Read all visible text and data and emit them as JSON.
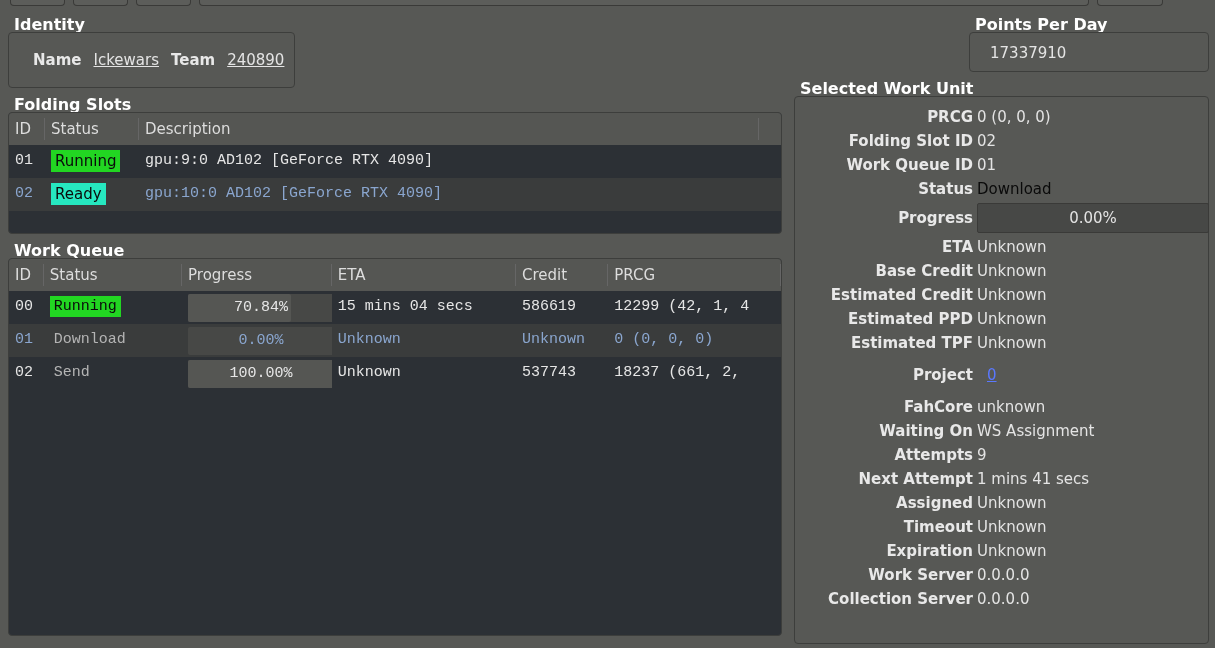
{
  "identity": {
    "title": "Identity",
    "name_label": "Name",
    "name": "Ickewars",
    "team_label": "Team",
    "team": "240890"
  },
  "points_per_day": {
    "title": "Points Per Day",
    "value": "17337910"
  },
  "folding_slots": {
    "title": "Folding Slots",
    "columns": [
      "ID",
      "Status",
      "Description"
    ],
    "rows": [
      {
        "id": "01",
        "status": "Running",
        "color": "#22d622",
        "description": "gpu:9:0 AD102 [GeForce RTX 4090]",
        "selected": false
      },
      {
        "id": "02",
        "status": "Ready",
        "color": "#26e8c0",
        "description": "gpu:10:0 AD102 [GeForce RTX 4090]",
        "selected": true
      }
    ]
  },
  "work_queue": {
    "title": "Work Queue",
    "columns": [
      "ID",
      "Status",
      "Progress",
      "ETA",
      "Credit",
      "PRCG"
    ],
    "rows": [
      {
        "id": "00",
        "status": "Running",
        "color": "#22d622",
        "progress": "70.84%",
        "level": 0.7084,
        "eta": "15 mins 04 secs",
        "credit": "586619",
        "prcg": "12299 (42, 1, 4",
        "selected": false
      },
      {
        "id": "01",
        "status": "Download",
        "progress": "0.00%",
        "level": 0,
        "eta": "Unknown",
        "credit": "Unknown",
        "prcg": "0 (0, 0, 0)",
        "selected": true
      },
      {
        "id": "02",
        "status": "Send",
        "progress": "100.00%",
        "level": 1,
        "eta": "Unknown",
        "credit": "537743",
        "prcg": "18237 (661, 2,",
        "selected": false
      }
    ]
  },
  "selected_work_unit": {
    "title": "Selected Work Unit",
    "fields": [
      {
        "kind": "text",
        "label": "PRCG",
        "value": "0 (0, 0, 0)"
      },
      {
        "kind": "text",
        "label": "Folding Slot ID",
        "value": "02"
      },
      {
        "kind": "text",
        "label": "Work Queue ID",
        "value": "01"
      },
      {
        "kind": "status",
        "label": "Status",
        "value": "Download"
      },
      {
        "kind": "progress",
        "label": "Progress",
        "value": "0.00%",
        "level": 0
      },
      {
        "kind": "text",
        "label": "ETA",
        "value": "Unknown"
      },
      {
        "kind": "text",
        "label": "Base Credit",
        "value": "Unknown"
      },
      {
        "kind": "text",
        "label": "Estimated Credit",
        "value": "Unknown"
      },
      {
        "kind": "text",
        "label": "Estimated PPD",
        "value": "Unknown"
      },
      {
        "kind": "text",
        "label": "Estimated TPF",
        "value": "Unknown"
      },
      {
        "kind": "link",
        "label": "Project",
        "value": "0"
      },
      {
        "kind": "text",
        "label": "FahCore",
        "value": "unknown"
      },
      {
        "kind": "text",
        "label": "Waiting On",
        "value": "WS Assignment"
      },
      {
        "kind": "text",
        "label": "Attempts",
        "value": "9"
      },
      {
        "kind": "text",
        "label": "Next Attempt",
        "value": "1 mins 41 secs"
      },
      {
        "kind": "text",
        "label": "Assigned",
        "value": "Unknown"
      },
      {
        "kind": "text",
        "label": "Timeout",
        "value": "Unknown"
      },
      {
        "kind": "text",
        "label": "Expiration",
        "value": "Unknown"
      },
      {
        "kind": "text",
        "label": "Work Server",
        "value": "0.0.0.0"
      },
      {
        "kind": "text",
        "label": "Collection Server",
        "value": "0.0.0.0"
      }
    ]
  }
}
